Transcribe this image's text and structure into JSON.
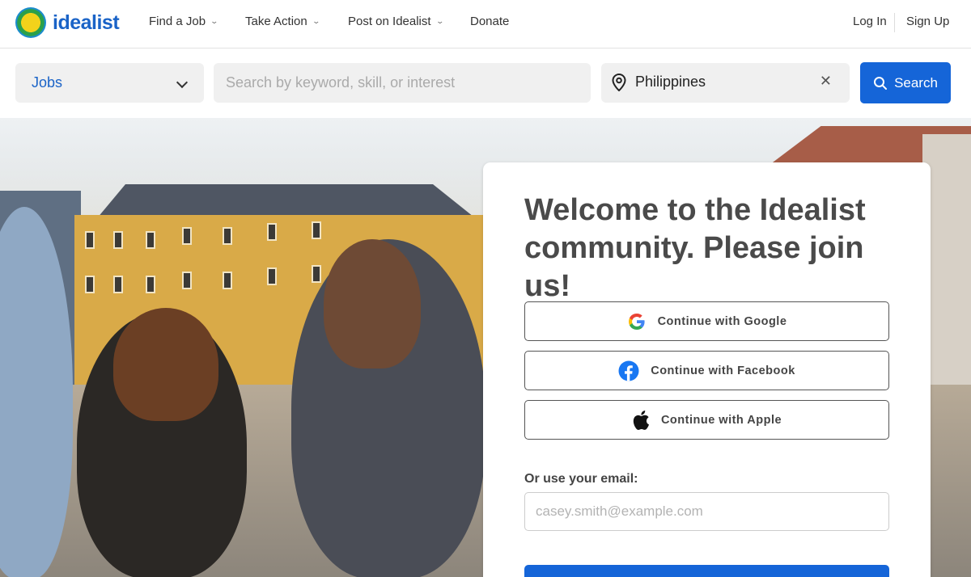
{
  "brand": {
    "name": "idealist"
  },
  "nav": {
    "items": [
      {
        "label": "Find a Job",
        "has_menu": true
      },
      {
        "label": "Take Action",
        "has_menu": true
      },
      {
        "label": "Post on Idealist",
        "has_menu": true
      },
      {
        "label": "Donate",
        "has_menu": false
      }
    ],
    "login": "Log In",
    "signup": "Sign Up"
  },
  "search": {
    "category": "Jobs",
    "keyword_placeholder": "Search by keyword, skill, or interest",
    "keyword_value": "",
    "location": "Philippines",
    "button": "Search"
  },
  "signup_card": {
    "title": "Welcome to the Idealist community. Please join us!",
    "google": "Continue with Google",
    "facebook": "Continue with Facebook",
    "apple": "Continue with Apple",
    "email_label": "Or use your email:",
    "email_placeholder": "casey.smith@example.com"
  },
  "colors": {
    "brand_blue": "#1a63c7",
    "primary_button": "#1565d8",
    "facebook_blue": "#1877f2"
  }
}
